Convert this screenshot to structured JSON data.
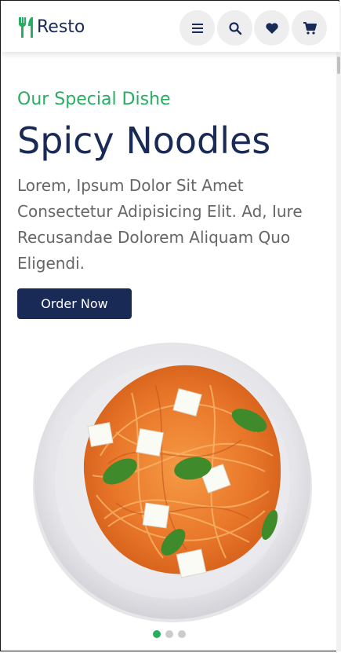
{
  "header": {
    "logo_text": "Resto",
    "icons": [
      "menu-icon",
      "search-icon",
      "heart-icon",
      "cart-icon"
    ]
  },
  "hero": {
    "subtitle": "Our Special Dishe",
    "title": "Spicy Noodles",
    "description": "Lorem, Ipsum Dolor Sit Amet Consectetur Adipisicing Elit. Ad, Iure Recusandae Dolorem Aliquam Quo Eligendi.",
    "button_label": "Order Now",
    "slides_total": 3,
    "active_slide": 1
  },
  "colors": {
    "primary": "#192a56",
    "accent": "#27ae60",
    "text": "#666666"
  }
}
